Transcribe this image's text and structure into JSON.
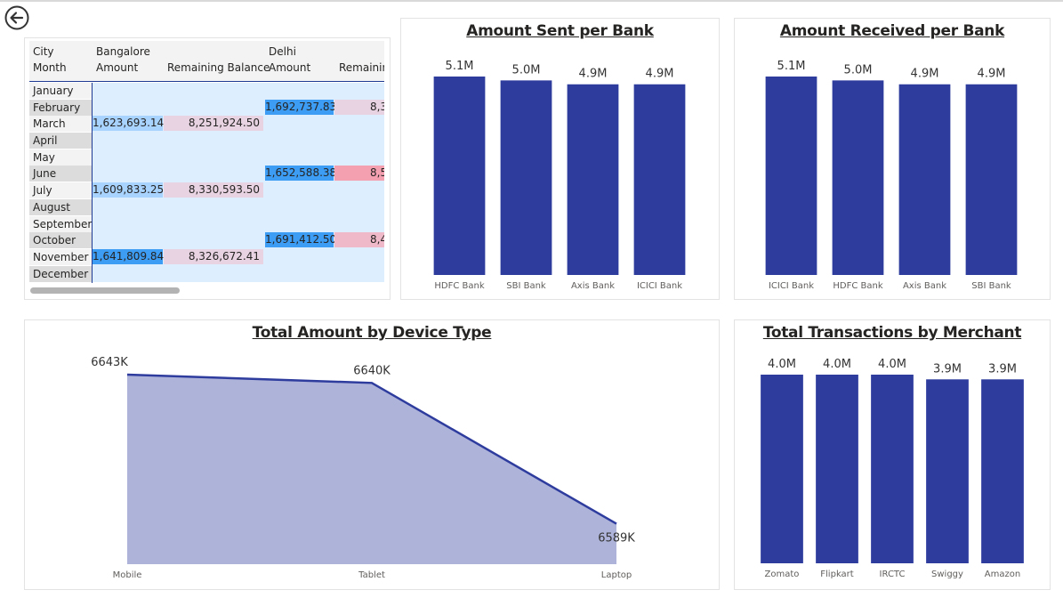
{
  "nav": {
    "back_icon": "back-arrow-circle-icon"
  },
  "matrix": {
    "row_header_1": "City",
    "row_header_2": "Month",
    "cities": [
      "Bangalore",
      "Delhi"
    ],
    "columns": [
      "Amount",
      "Remaining Balance",
      "Amount",
      "Remainin"
    ],
    "months": [
      "January",
      "February",
      "March",
      "April",
      "May",
      "June",
      "July",
      "August",
      "September",
      "October",
      "November",
      "December"
    ],
    "rows": [
      [
        "",
        "",
        "",
        ""
      ],
      [
        "",
        "",
        "1,692,737.83",
        "8,3"
      ],
      [
        "1,623,693.14",
        "8,251,924.50",
        "",
        ""
      ],
      [
        "",
        "",
        "",
        ""
      ],
      [
        "",
        "",
        "",
        ""
      ],
      [
        "",
        "",
        "1,652,588.38",
        "8,5"
      ],
      [
        "1,609,833.25",
        "8,330,593.50",
        "",
        ""
      ],
      [
        "",
        "",
        "",
        ""
      ],
      [
        "",
        "",
        "",
        ""
      ],
      [
        "",
        "",
        "1,691,412.50",
        "8,4"
      ],
      [
        "1,641,809.84",
        "8,326,672.41",
        "",
        ""
      ],
      [
        "",
        "",
        "",
        ""
      ]
    ],
    "colors": {
      "amount_light": "#a8d3ff",
      "amount_dark": "#3d9df5",
      "balance_light": "#e8d3e2",
      "balance_mid": "#f0b9c9",
      "balance_dark": "#f5a0b0",
      "cell_bg": "#ddeeff"
    }
  },
  "charts": {
    "sent": {
      "title": "Amount Sent per Bank",
      "chart_data": {
        "type": "bar",
        "categories": [
          "HDFC Bank",
          "SBI Bank",
          "Axis Bank",
          "ICICI Bank"
        ],
        "values": [
          5.1,
          5.0,
          4.9,
          4.9
        ],
        "labels": [
          "5.1M",
          "5.0M",
          "4.9M",
          "4.9M"
        ],
        "unit": "M",
        "color": "#2e3c9e"
      }
    },
    "received": {
      "title": "Amount Received per Bank",
      "chart_data": {
        "type": "bar",
        "categories": [
          "ICICI Bank",
          "HDFC Bank",
          "Axis Bank",
          "SBI Bank"
        ],
        "values": [
          5.1,
          5.0,
          4.9,
          4.9
        ],
        "labels": [
          "5.1M",
          "5.0M",
          "4.9M",
          "4.9M"
        ],
        "unit": "M",
        "color": "#2e3c9e"
      }
    },
    "device": {
      "title": "Total Amount by Device Type",
      "chart_data": {
        "type": "area",
        "categories": [
          "Mobile",
          "Tablet",
          "Laptop"
        ],
        "values": [
          6643,
          6640,
          6589
        ],
        "labels": [
          "6643K",
          "6640K",
          "6589K"
        ],
        "unit": "K",
        "line_color": "#2e3c9e",
        "fill_color": "#aeb3da"
      }
    },
    "merchant": {
      "title": "Total Transactions by Merchant",
      "chart_data": {
        "type": "bar",
        "categories": [
          "Zomato",
          "Flipkart",
          "IRCTC",
          "Swiggy",
          "Amazon"
        ],
        "values": [
          4.0,
          4.0,
          4.0,
          3.9,
          3.9
        ],
        "labels": [
          "4.0M",
          "4.0M",
          "4.0M",
          "3.9M",
          "3.9M"
        ],
        "unit": "M",
        "color": "#2e3c9e"
      }
    }
  }
}
